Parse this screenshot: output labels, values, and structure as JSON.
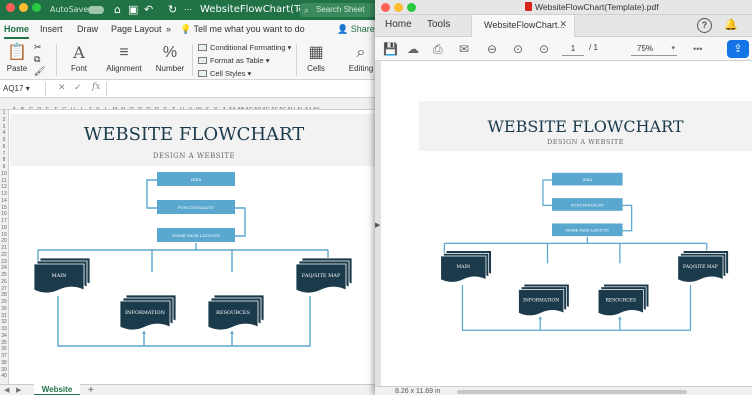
{
  "excel": {
    "title_bar": {
      "autosave_label": "AutoSave",
      "doc_title": "WebsiteFlowChart(Te...",
      "search_placeholder": "Search Sheet"
    },
    "tabs": [
      "Home",
      "Insert",
      "Draw",
      "Page Layout"
    ],
    "more_tabs": "»",
    "tell_me": "Tell me what you want to do",
    "share": "Share",
    "ribbon": {
      "paste": "Paste",
      "font": "Font",
      "alignment": "Alignment",
      "number": "Number",
      "conditional_formatting": "Conditional Formatting",
      "format_as_table": "Format as Table",
      "cell_styles": "Cell Styles",
      "cells": "Cells",
      "editing": "Editing"
    },
    "name_box": "AQ17",
    "fx_label": "fx",
    "columns": [
      "A",
      "B",
      "C",
      "D",
      "E",
      "F",
      "G",
      "H",
      "I",
      "J",
      "K",
      "L",
      "M",
      "N",
      "O",
      "P",
      "Q",
      "R",
      "S",
      "T",
      "U",
      "V",
      "W",
      "X",
      "Y",
      "Z",
      "AA",
      "AB",
      "AC",
      "AD",
      "AE",
      "AF",
      "AG",
      "AH",
      "AI",
      "AJ",
      "AK"
    ],
    "rows": [
      "1",
      "2",
      "3",
      "4",
      "5",
      "6",
      "7",
      "8",
      "9",
      "10",
      "11",
      "12",
      "13",
      "14",
      "15",
      "16",
      "17",
      "18",
      "19",
      "20",
      "21",
      "22",
      "23",
      "24",
      "25",
      "26",
      "27",
      "28",
      "29",
      "30",
      "31",
      "32",
      "33",
      "34",
      "35",
      "36",
      "37",
      "38",
      "39",
      "40"
    ],
    "sheet_tab": "Website",
    "add_sheet": "+",
    "nav_prev": "◀",
    "nav_next": "▶"
  },
  "flowchart": {
    "title": "WEBSITE FLOWCHART",
    "subtitle": "DESIGN A WEBSITE",
    "steps": [
      "IDEA",
      "FUNCTIONALITY",
      "HOME PAGE LAYOUTS"
    ],
    "pages": [
      "MAIN",
      "INFORMATION",
      "RESOURCES",
      "FAQ/SITE MAP"
    ],
    "colors": {
      "box": "#5aa7cf",
      "doc": "#1b3a4b",
      "line": "#5aa7cf",
      "band": "#f2f2f2",
      "title": "#1b3a4b"
    }
  },
  "pdf": {
    "window_title": "WebsiteFlowChart(Template).pdf",
    "tabs": [
      "Home",
      "Tools"
    ],
    "doc_tab": "WebsiteFlowChart...",
    "close": "✕",
    "help": "?",
    "page_current": "1",
    "page_total": "/ 1",
    "zoom": "75%",
    "more": "•••",
    "page_size": "8.26 x 11.69 in"
  },
  "colors": {
    "excel_green": "#217346",
    "acrobat_blue": "#1473e6"
  }
}
